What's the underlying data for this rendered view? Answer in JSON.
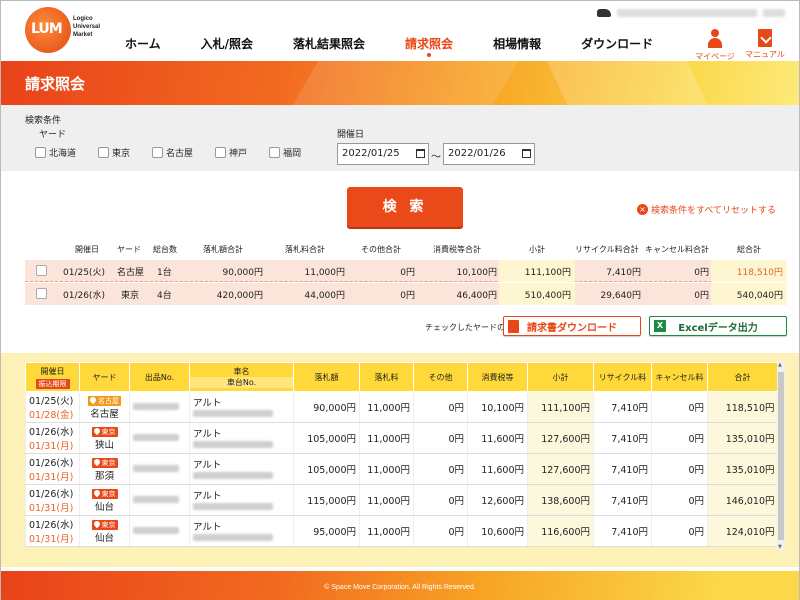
{
  "header": {
    "brand": [
      "Logico",
      "Universal",
      "Market"
    ],
    "logo_text": "LUM",
    "nav": [
      {
        "label": "ホーム",
        "active": false
      },
      {
        "label": "入札/照会",
        "active": false
      },
      {
        "label": "落札結果照会",
        "active": false
      },
      {
        "label": "請求照会",
        "active": true
      },
      {
        "label": "相場情報",
        "active": false
      },
      {
        "label": "ダウンロード",
        "active": false
      }
    ],
    "mypage_label": "マイページ",
    "manual_label": "マニュアル"
  },
  "page_title": "請求照会",
  "search": {
    "section_label": "検索条件",
    "yard_label": "ヤード",
    "yards": [
      "北海道",
      "東京",
      "名古屋",
      "神戸",
      "福岡"
    ],
    "date_label": "開催日",
    "date_from": "2022/01/25",
    "date_to": "2022/01/26",
    "tilde": "～",
    "button": "検 索",
    "reset": "検索条件をすべてリセットする"
  },
  "summary": {
    "headers": [
      "開催日",
      "ヤード",
      "総台数",
      "落札額合計",
      "落札料合計",
      "その他合計",
      "消費税等合計",
      "小計",
      "リサイクル料合計",
      "キャンセル料合計",
      "総合計"
    ],
    "rows": [
      [
        "01/25(火)",
        "名古屋",
        "1台",
        "90,000円",
        "11,000円",
        "0円",
        "10,100円",
        "111,100円",
        "7,410円",
        "0円",
        "118,510円"
      ],
      [
        "01/26(水)",
        "東京",
        "4台",
        "420,000円",
        "44,000円",
        "0円",
        "46,400円",
        "510,400円",
        "29,640円",
        "0円",
        "540,040円"
      ]
    ]
  },
  "actions": {
    "note": "チェックしたヤードの",
    "pdf": "請求書ダウンロード",
    "excel": "Excelデータ出力",
    "excel_icon": "X"
  },
  "detail": {
    "headers": {
      "date": "開催日",
      "due": "振込期限",
      "yard": "ヤード",
      "lot": "出品No.",
      "car": "車名",
      "chassis": "車台No.",
      "bid": "落札額",
      "fee": "落札料",
      "other": "その他",
      "tax": "消費税等",
      "subtotal": "小計",
      "recycle": "リサイクル料",
      "cancel": "キャンセル料",
      "total": "合計"
    },
    "rows": [
      {
        "date": "01/25(火)",
        "due": "01/28(金)",
        "badge": "名古屋",
        "badge_color": "orange",
        "yard": "名古屋",
        "car": "アルト",
        "bid": "90,000円",
        "fee": "11,000円",
        "other": "0円",
        "tax": "10,100円",
        "subtotal": "111,100円",
        "recycle": "7,410円",
        "cancel": "0円",
        "total": "118,510円"
      },
      {
        "date": "01/26(水)",
        "due": "01/31(月)",
        "badge": "東京",
        "badge_color": "red",
        "yard": "狭山",
        "car": "アルト",
        "bid": "105,000円",
        "fee": "11,000円",
        "other": "0円",
        "tax": "11,600円",
        "subtotal": "127,600円",
        "recycle": "7,410円",
        "cancel": "0円",
        "total": "135,010円"
      },
      {
        "date": "01/26(水)",
        "due": "01/31(月)",
        "badge": "東京",
        "badge_color": "red",
        "yard": "那須",
        "car": "アルト",
        "bid": "105,000円",
        "fee": "11,000円",
        "other": "0円",
        "tax": "11,600円",
        "subtotal": "127,600円",
        "recycle": "7,410円",
        "cancel": "0円",
        "total": "135,010円"
      },
      {
        "date": "01/26(水)",
        "due": "01/31(月)",
        "badge": "東京",
        "badge_color": "red",
        "yard": "仙台",
        "car": "アルト",
        "bid": "115,000円",
        "fee": "11,000円",
        "other": "0円",
        "tax": "12,600円",
        "subtotal": "138,600円",
        "recycle": "7,410円",
        "cancel": "0円",
        "total": "146,010円"
      },
      {
        "date": "01/26(水)",
        "due": "01/31(月)",
        "badge": "東京",
        "badge_color": "red",
        "yard": "仙台",
        "car": "アルト",
        "bid": "95,000円",
        "fee": "11,000円",
        "other": "0円",
        "tax": "10,600円",
        "subtotal": "116,600円",
        "recycle": "7,410円",
        "cancel": "0円",
        "total": "124,010円"
      }
    ]
  },
  "footer": "© Space Move Corporation. All Rights Reserved.",
  "colors": {
    "accent": "#e84818",
    "header_yellow": "#ffd83a",
    "detail_bg": "#fdf1b8"
  }
}
